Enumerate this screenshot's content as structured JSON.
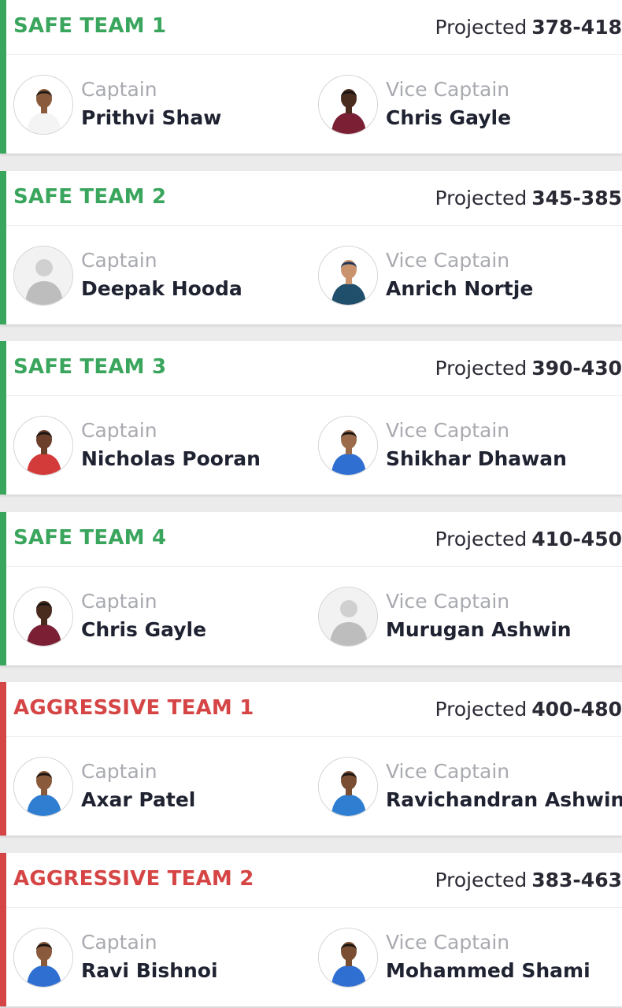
{
  "labels": {
    "projected": "Projected",
    "captain": "Captain",
    "vice_captain": "Vice Captain"
  },
  "colors": {
    "safe": "#3aa55c",
    "aggressive": "#d64545"
  },
  "teams": [
    {
      "name": "SAFE TEAM 1",
      "type": "safe",
      "range": "378-418",
      "captain": {
        "name": "Prithvi Shaw",
        "jersey": "#f4f4f4",
        "skin": "#8a5a3c",
        "hair": "#1f1a17",
        "placeholder": false
      },
      "vice_captain": {
        "name": "Chris Gayle",
        "jersey": "#7b1f35",
        "skin": "#4a2c1f",
        "hair": "#1a1412",
        "placeholder": false
      }
    },
    {
      "name": "SAFE TEAM 2",
      "type": "safe",
      "range": "345-385",
      "captain": {
        "name": "Deepak Hooda",
        "jersey": "#bdbdbd",
        "skin": "#d0d0d0",
        "hair": "#c4c4c4",
        "placeholder": true
      },
      "vice_captain": {
        "name": "Anrich Nortje",
        "jersey": "#1f4f6b",
        "skin": "#c9936e",
        "hair": "#1d3557",
        "placeholder": false
      }
    },
    {
      "name": "SAFE TEAM 3",
      "type": "safe",
      "range": "390-430",
      "captain": {
        "name": "Nicholas Pooran",
        "jersey": "#d33a3a",
        "skin": "#6b3f2a",
        "hair": "#1a1412",
        "placeholder": false
      },
      "vice_captain": {
        "name": "Shikhar Dhawan",
        "jersey": "#2f6fd1",
        "skin": "#9a6a4a",
        "hair": "#1a1412",
        "placeholder": false
      }
    },
    {
      "name": "SAFE TEAM 4",
      "type": "safe",
      "range": "410-450",
      "captain": {
        "name": "Chris Gayle",
        "jersey": "#7b1f35",
        "skin": "#4a2c1f",
        "hair": "#1a1412",
        "placeholder": false
      },
      "vice_captain": {
        "name": "Murugan Ashwin",
        "jersey": "#bdbdbd",
        "skin": "#d0d0d0",
        "hair": "#c4c4c4",
        "placeholder": true
      }
    },
    {
      "name": "AGGRESSIVE TEAM 1",
      "type": "aggressive",
      "range": "400-480",
      "captain": {
        "name": "Axar Patel",
        "jersey": "#2f7ed1",
        "skin": "#8a5a3c",
        "hair": "#1a1412",
        "placeholder": false
      },
      "vice_captain": {
        "name": "Ravichandran Ashwin",
        "jersey": "#2f7ed1",
        "skin": "#7a4e33",
        "hair": "#1a1412",
        "placeholder": false
      }
    },
    {
      "name": "AGGRESSIVE TEAM 2",
      "type": "aggressive",
      "range": "383-463",
      "captain": {
        "name": "Ravi Bishnoi",
        "jersey": "#2f6fd1",
        "skin": "#8a5a3c",
        "hair": "#1a1412",
        "placeholder": false
      },
      "vice_captain": {
        "name": "Mohammed Shami",
        "jersey": "#2f6fd1",
        "skin": "#7a4e33",
        "hair": "#1a1412",
        "placeholder": false
      }
    }
  ]
}
